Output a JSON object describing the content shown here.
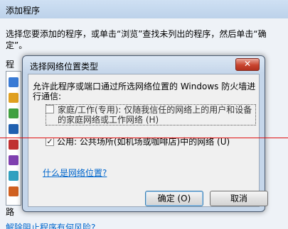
{
  "outer": {
    "title": "添加程序",
    "prompt": "选择您要添加的程序，或单击“浏览”查找未列出的程序，然后单击“确定”。",
    "programs_label": "程",
    "path_label": "路",
    "risk_link": "解除阻止程序有何风险?"
  },
  "dialog": {
    "title": "选择网络位置类型",
    "close_symbol": "✕",
    "intro": "允许此程序或端口通过所选网络位置的 Windows 防火墙进行通信:",
    "options": [
      {
        "label": "家庭/工作(专用): 仅随我信任的网络上的用户和设备的家庭网络或工作网络 (H)",
        "checked": false
      },
      {
        "label": "公用: 公共场所(如机场或咖啡店)中的网络 (U)",
        "checked": true
      }
    ],
    "what_link": "什么是网络位置?",
    "ok_label": "确定 (O)",
    "cancel_label": "取消"
  },
  "colors": {
    "red_line": "#e01010",
    "link": "#0066cc",
    "close_button": "#c9452f"
  }
}
